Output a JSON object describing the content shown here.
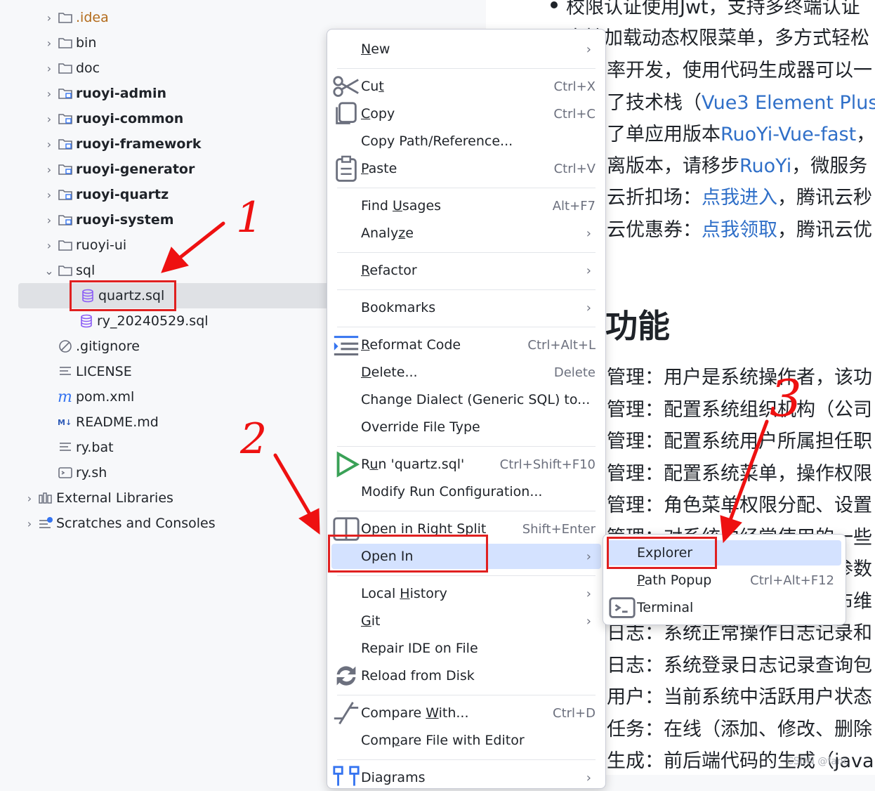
{
  "tree": {
    "items": [
      {
        "label": ".idea",
        "icon": "folder-icon",
        "chevron": "right",
        "style": "orange"
      },
      {
        "label": "bin",
        "icon": "folder-icon",
        "chevron": "right"
      },
      {
        "label": "doc",
        "icon": "folder-icon",
        "chevron": "right"
      },
      {
        "label": "ruoyi-admin",
        "icon": "module-folder-icon",
        "chevron": "right",
        "style": "bold"
      },
      {
        "label": "ruoyi-common",
        "icon": "module-folder-icon",
        "chevron": "right",
        "style": "bold"
      },
      {
        "label": "ruoyi-framework",
        "icon": "module-folder-icon",
        "chevron": "right",
        "style": "bold"
      },
      {
        "label": "ruoyi-generator",
        "icon": "module-folder-icon",
        "chevron": "right",
        "style": "bold"
      },
      {
        "label": "ruoyi-quartz",
        "icon": "module-folder-icon",
        "chevron": "right",
        "style": "bold"
      },
      {
        "label": "ruoyi-system",
        "icon": "module-folder-icon",
        "chevron": "right",
        "style": "bold"
      },
      {
        "label": "ruoyi-ui",
        "icon": "folder-icon",
        "chevron": "right"
      },
      {
        "label": "sql",
        "icon": "folder-icon",
        "chevron": "down"
      },
      {
        "label": "quartz.sql",
        "icon": "database-icon",
        "selected": true
      },
      {
        "label": "ry_20240529.sql",
        "icon": "database-icon"
      },
      {
        "label": ".gitignore",
        "icon": "ignore-icon"
      },
      {
        "label": "LICENSE",
        "icon": "text-icon"
      },
      {
        "label": "pom.xml",
        "icon": "maven-icon"
      },
      {
        "label": "README.md",
        "icon": "markdown-icon"
      },
      {
        "label": "ry.bat",
        "icon": "text-icon"
      },
      {
        "label": "ry.sh",
        "icon": "shell-icon"
      },
      {
        "label": "External Libraries",
        "icon": "library-icon",
        "chevron": "right"
      },
      {
        "label": "Scratches and Consoles",
        "icon": "scratches-icon",
        "chevron": "right"
      }
    ]
  },
  "editor": {
    "lines": [
      {
        "pre": "校限认证使用Jwt，支持多终端认证",
        "link": "",
        "post": ""
      },
      {
        "pre": "支持加载动态权限菜单，多方式轻松",
        "link": "",
        "post": ""
      },
      {
        "pre": "率开发，使用代码生成器可以一",
        "link": "",
        "post": ""
      },
      {
        "pre": "了技术栈（",
        "link": "Vue3 Element Plus",
        "post": ""
      },
      {
        "pre": "了单应用版本",
        "link": "RuoYi-Vue-fast",
        "post": "，"
      },
      {
        "pre": "离版本，请移步",
        "link": "RuoYi",
        "post": "，微服务"
      },
      {
        "pre": "云折扣场：",
        "link": "点我进入",
        "post": "，腾讯云秒"
      },
      {
        "pre": "云优惠券：",
        "link": "点我领取",
        "post": "，腾讯云优"
      }
    ],
    "heading": "功能",
    "features": [
      "管理：用户是系统操作者，该功",
      "管理：配置系统组织机构（公司",
      "管理：配置系统用户所属担任职",
      "管理：配置系统菜单，操作权限",
      "管理：角色菜单权限分配、设置",
      "管理：对系统中经常使用的一些",
      "管理：对系统动态配置常用参数",
      "公告：系统通知公告信息发布维",
      "日志：系统正常操作日志记录和",
      "日志：系统登录日志记录查询包",
      "用户：当前系统中活跃用户状态",
      "任务：在线（添加、修改、删除",
      "生成：前后端代码的生成（java"
    ]
  },
  "menu": {
    "items": [
      {
        "label": "New",
        "mn": "N",
        "arrow": true
      },
      {
        "sep": true
      },
      {
        "label": "Cut",
        "mn": "t",
        "shortcut": "Ctrl+X",
        "icon": "scissors-icon"
      },
      {
        "label": "Copy",
        "mn": "C",
        "shortcut": "Ctrl+C",
        "icon": "copy-icon"
      },
      {
        "label": "Copy Path/Reference..."
      },
      {
        "label": "Paste",
        "mn": "P",
        "shortcut": "Ctrl+V",
        "icon": "paste-icon"
      },
      {
        "sep": true
      },
      {
        "label": "Find Usages",
        "mn": "U",
        "shortcut": "Alt+F7"
      },
      {
        "label": "Analyze",
        "mn": "z",
        "arrow": true
      },
      {
        "sep": true
      },
      {
        "label": "Refactor",
        "mn": "R",
        "arrow": true
      },
      {
        "sep": true
      },
      {
        "label": "Bookmarks",
        "arrow": true
      },
      {
        "sep": true
      },
      {
        "label": "Reformat Code",
        "mn": "R",
        "shortcut": "Ctrl+Alt+L",
        "icon": "reformat-icon"
      },
      {
        "label": "Delete...",
        "mn": "D",
        "shortcut": "Delete"
      },
      {
        "label": "Change Dialect (Generic SQL) to..."
      },
      {
        "label": "Override File Type"
      },
      {
        "sep": true
      },
      {
        "label": "Run 'quartz.sql'",
        "mn": "u",
        "shortcut": "Ctrl+Shift+F10",
        "icon": "run-icon"
      },
      {
        "label": "Modify Run Configuration..."
      },
      {
        "sep": true
      },
      {
        "label": "Open in Right Split",
        "shortcut": "Shift+Enter",
        "icon": "split-icon"
      },
      {
        "label": "Open In",
        "arrow": true,
        "highlight": true
      },
      {
        "sep": true
      },
      {
        "label": "Local History",
        "mn": "H",
        "arrow": true
      },
      {
        "label": "Git",
        "mn": "G",
        "arrow": true
      },
      {
        "label": "Repair IDE on File"
      },
      {
        "label": "Reload from Disk",
        "icon": "reload-icon"
      },
      {
        "sep": true
      },
      {
        "label": "Compare With...",
        "mn": "W",
        "shortcut": "Ctrl+D",
        "icon": "compare-icon"
      },
      {
        "label": "Compare File with Editor",
        "mn": "p"
      },
      {
        "sep": true
      },
      {
        "label": "Diagrams",
        "arrow": true,
        "icon": "diagram-icon"
      }
    ]
  },
  "submenu": {
    "items": [
      {
        "label": "Explorer",
        "highlight": true
      },
      {
        "label": "Path Popup",
        "mn": "P",
        "shortcut": "Ctrl+Alt+F12"
      },
      {
        "label": "Terminal",
        "icon": "terminal-icon"
      }
    ]
  },
  "annotations": {
    "one": "1",
    "two": "2",
    "three": "3"
  },
  "watermark": "CSDN @fanc"
}
